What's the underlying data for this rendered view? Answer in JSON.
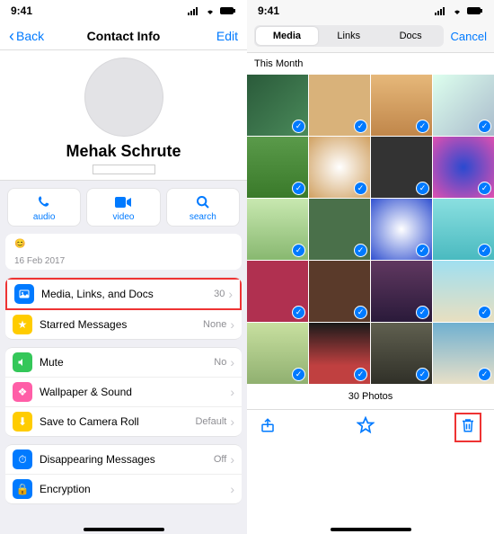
{
  "status": {
    "time": "9:41"
  },
  "left": {
    "nav": {
      "back": "Back",
      "title": "Contact Info",
      "edit": "Edit"
    },
    "contact_name": "Mehak Schrute",
    "actions": {
      "audio": "audio",
      "video": "video",
      "search": "search"
    },
    "about_emoji": "😊",
    "about_date": "16 Feb 2017",
    "rows": {
      "media": {
        "label": "Media, Links, and Docs",
        "value": "30"
      },
      "starred": {
        "label": "Starred Messages",
        "value": "None"
      },
      "mute": {
        "label": "Mute",
        "value": "No"
      },
      "wallpaper": {
        "label": "Wallpaper & Sound",
        "value": ""
      },
      "saveroll": {
        "label": "Save to Camera Roll",
        "value": "Default"
      },
      "disappearing": {
        "label": "Disappearing Messages",
        "value": "Off"
      },
      "encryption": {
        "label": "Encryption",
        "value": ""
      }
    }
  },
  "right": {
    "seg": {
      "media": "Media",
      "links": "Links",
      "docs": "Docs"
    },
    "cancel": "Cancel",
    "section": "This Month",
    "count_label": "30 Photos"
  }
}
